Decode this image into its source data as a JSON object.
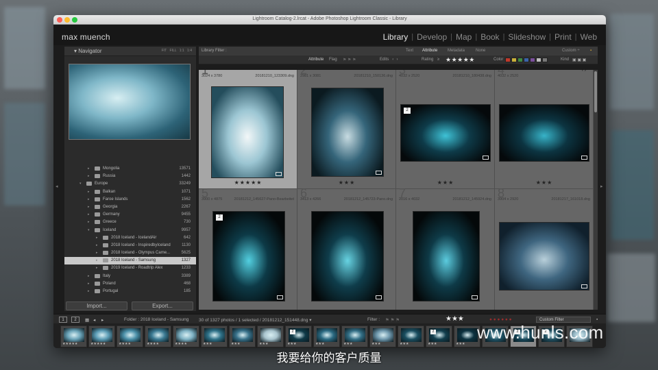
{
  "window": {
    "title": "Lightroom Catalog-2.lrcat - Adobe Photoshop Lightroom Classic - Library"
  },
  "identity": {
    "plate": "max muench",
    "modules": [
      "Library",
      "Develop",
      "Map",
      "Book",
      "Slideshow",
      "Print",
      "Web"
    ],
    "active_module": "Library"
  },
  "navigator": {
    "title": "Navigator",
    "zoom_options": "FIT  FILL  1:1  1:4"
  },
  "folders": [
    {
      "name": "Mongolia",
      "count": "13571",
      "level": 1,
      "expanded": false,
      "selected": false
    },
    {
      "name": "Russia",
      "count": "1442",
      "level": 1,
      "expanded": false,
      "selected": false
    },
    {
      "name": "Europe",
      "count": "33249",
      "level": 0,
      "expanded": true,
      "selected": false
    },
    {
      "name": "Balkan",
      "count": "1071",
      "level": 1,
      "expanded": false,
      "selected": false
    },
    {
      "name": "Faroe Islands",
      "count": "1562",
      "level": 1,
      "expanded": false,
      "selected": false
    },
    {
      "name": "Georgia",
      "count": "2267",
      "level": 1,
      "expanded": false,
      "selected": false
    },
    {
      "name": "Germany",
      "count": "9455",
      "level": 1,
      "expanded": false,
      "selected": false
    },
    {
      "name": "Greece",
      "count": "730",
      "level": 1,
      "expanded": false,
      "selected": false
    },
    {
      "name": "Iceland",
      "count": "9957",
      "level": 1,
      "expanded": true,
      "selected": false
    },
    {
      "name": "2018 Iceland - IcelandAir",
      "count": "642",
      "level": 2,
      "expanded": false,
      "selected": false
    },
    {
      "name": "2018 Iceland - InspiredbyIceland",
      "count": "1130",
      "level": 2,
      "expanded": false,
      "selected": false
    },
    {
      "name": "2018 Iceland - Olympus Came...",
      "count": "5625",
      "level": 2,
      "expanded": false,
      "selected": false
    },
    {
      "name": "2018 Iceland - Samsung",
      "count": "1327",
      "level": 2,
      "expanded": false,
      "selected": true
    },
    {
      "name": "2019 Iceland - Roadtrip Alex",
      "count": "1233",
      "level": 2,
      "expanded": false,
      "selected": false
    },
    {
      "name": "Italy",
      "count": "3389",
      "level": 1,
      "expanded": false,
      "selected": false
    },
    {
      "name": "Poland",
      "count": "468",
      "level": 1,
      "expanded": false,
      "selected": false
    },
    {
      "name": "Portugal",
      "count": "185",
      "level": 1,
      "expanded": false,
      "selected": false
    }
  ],
  "panel": {
    "import_label": "Import...",
    "export_label": "Export..."
  },
  "filter": {
    "label": "Library Filter :",
    "tabs": [
      "Text",
      "Attribute",
      "Metadata",
      "None"
    ],
    "preset": "Custom ÷"
  },
  "attribute": {
    "label": "Attribute",
    "flag": "Flag",
    "edits": "Edits",
    "rating": "Rating",
    "rating_op": "≥",
    "stars": "★★★★★",
    "color": "Color",
    "kind": "Kind"
  },
  "grid_cells": [
    {
      "index": "1",
      "dims": "3024 x 3780",
      "file": "20181210_123309.dng",
      "stars": "★★★★★",
      "selected": true,
      "badge": "",
      "copy": "",
      "colors": [
        "#f2f7f8",
        "#9cc6d3",
        "#244d5c"
      ]
    },
    {
      "index": "2",
      "dims": "2981 x 3081",
      "file": "20181210_150136.dng",
      "stars": "★★★",
      "selected": false,
      "badge": "",
      "copy": "",
      "colors": [
        "#c7dbe1",
        "#35657a",
        "#0b1a20"
      ]
    },
    {
      "index": "3",
      "dims": "4032 x 2520",
      "file": "20181210_180438.dng",
      "stars": "★★★",
      "selected": false,
      "badge": "2",
      "copy": "",
      "colors": [
        "#3ec2d6",
        "#0e3b49",
        "#05090b"
      ]
    },
    {
      "index": "4",
      "dims": "4032 x 2520",
      "file": "",
      "stars": "★★★",
      "selected": false,
      "badge": "",
      "copy": "Copy 1",
      "colors": [
        "#37b3c8",
        "#0c3441",
        "#05090b"
      ]
    },
    {
      "index": "5",
      "dims": "3900 x 4875",
      "file": "20181212_145627-Pano-Bearbeitet",
      "stars": "",
      "selected": false,
      "badge": "2",
      "copy": "",
      "colors": [
        "#52cfe0",
        "#0d3a47",
        "#040809"
      ]
    },
    {
      "index": "6",
      "dims": "3413 x 4266",
      "file": "20181212_145723-Pano.dng",
      "stars": "",
      "selected": false,
      "badge": "",
      "copy": "",
      "colors": [
        "#67d3e2",
        "#0f3d4b",
        "#040809"
      ]
    },
    {
      "index": "7",
      "dims": "2016 x 4032",
      "file": "20181212_145924.dng",
      "stars": "",
      "selected": false,
      "badge": "",
      "copy": "",
      "colors": [
        "#5bcbde",
        "#0e3a47",
        "#040809"
      ]
    },
    {
      "index": "8",
      "dims": "3904 x 2920",
      "file": "20181217_161018.dng",
      "stars": "",
      "selected": false,
      "badge": "",
      "copy": "",
      "colors": [
        "#b8cfda",
        "#3f6680",
        "#10202c"
      ]
    }
  ],
  "status": {
    "page1": "1",
    "page2": "2",
    "folder": "Folder : 2018 Iceland - Samsung",
    "count": "30 of 1327 photos / 1 selected / 20181212_151448.dng ▾",
    "filter_label": "Filter :",
    "stars": "★★★",
    "custom_filter": "Custom Filter"
  },
  "filmstrip": [
    {
      "stars": "★★★★★",
      "badge": "",
      "color": "#6aa3b8",
      "selected": false,
      "num": ""
    },
    {
      "stars": "★★★★★",
      "badge": "",
      "color": "#5b9cb5",
      "selected": false,
      "num": ""
    },
    {
      "stars": "★★★★",
      "badge": "",
      "color": "#4a8fa8",
      "selected": false,
      "num": ""
    },
    {
      "stars": "★★★★",
      "badge": "",
      "color": "#3b7a93",
      "selected": false,
      "num": ""
    },
    {
      "stars": "★★★★",
      "badge": "",
      "color": "#7fb2c4",
      "selected": false,
      "num": ""
    },
    {
      "stars": "★★★",
      "badge": "",
      "color": "#2f7289",
      "selected": false,
      "num": ""
    },
    {
      "stars": "★★★",
      "badge": "",
      "color": "#38718a",
      "selected": false,
      "num": ""
    },
    {
      "stars": "★★★",
      "badge": "",
      "color": "#a9c4ce",
      "selected": false,
      "num": ""
    },
    {
      "stars": "★★★",
      "badge": "2",
      "color": "#0f3a48",
      "selected": false,
      "num": ""
    },
    {
      "stars": "★★★",
      "badge": "",
      "color": "#2b6a82",
      "selected": false,
      "num": ""
    },
    {
      "stars": "★★★",
      "badge": "",
      "color": "#336f86",
      "selected": false,
      "num": ""
    },
    {
      "stars": "★★★",
      "badge": "",
      "color": "#6f98ad",
      "selected": false,
      "num": ""
    },
    {
      "stars": "★★★",
      "badge": "",
      "color": "#1a4e60",
      "selected": false,
      "num": ""
    },
    {
      "stars": "★★★",
      "badge": "2",
      "color": "#123f4e",
      "selected": false,
      "num": ""
    },
    {
      "stars": "★★★",
      "badge": "",
      "color": "#0d3240",
      "selected": false,
      "num": ""
    },
    {
      "stars": "",
      "badge": "",
      "color": "#1f5366",
      "selected": false,
      "num": ""
    },
    {
      "stars": "",
      "badge": "2",
      "color": "#17485a",
      "selected": true,
      "num": ""
    },
    {
      "stars": "",
      "badge": "2",
      "color": "#204f60",
      "selected": false,
      "num": ""
    },
    {
      "stars": "",
      "badge": "",
      "color": "#8fb1c0",
      "selected": false,
      "num": ""
    }
  ],
  "overlay": {
    "watermark": "www.hunls.com",
    "subtitle": "我要给你的客户质量"
  }
}
